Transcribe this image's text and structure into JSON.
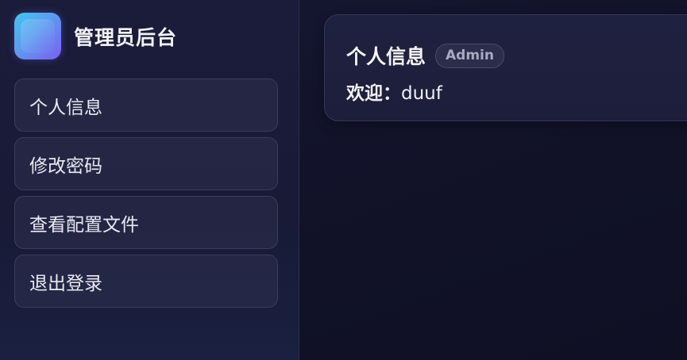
{
  "sidebar": {
    "logo_icon": "gradient-app-logo-icon",
    "title": "管理员后台",
    "items": [
      {
        "label": "个人信息"
      },
      {
        "label": "修改密码"
      },
      {
        "label": "查看配置文件"
      },
      {
        "label": "退出登录"
      }
    ]
  },
  "card": {
    "title": "个人信息",
    "role_badge": "Admin",
    "welcome_label": "欢迎：",
    "username": "duuf"
  },
  "colors": {
    "accent_gradient_start": "#3fc6f2",
    "accent_gradient_end": "#7b5ef0",
    "background": "#12132a"
  }
}
